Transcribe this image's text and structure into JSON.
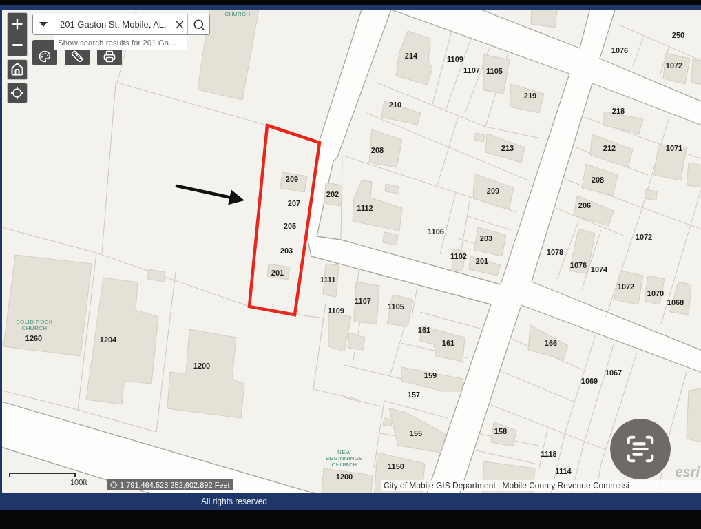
{
  "search": {
    "value": "201 Gaston St, Mobile, AL,",
    "suggestion": "Show search results for 201 Ga…"
  },
  "map": {
    "place_labels": [
      "CHURCH",
      "SOLID ROCK CHURCH",
      "NEW BEGINNINGS CHURCH"
    ],
    "address_labels": [
      "250",
      "1076",
      "214",
      "1109",
      "1072",
      "1107",
      "1105",
      "219",
      "210",
      "218",
      "208",
      "213",
      "212",
      "1071",
      "209",
      "208",
      "209",
      "202",
      "207",
      "206",
      "1112",
      "205",
      "1106",
      "1072",
      "203",
      "203",
      "1078",
      "1102",
      "201",
      "1076",
      "1074",
      "201",
      "1111",
      "1072",
      "1070",
      "1107",
      "1068",
      "1105",
      "1109",
      "161",
      "1260",
      "1204",
      "161",
      "166",
      "1200",
      "1067",
      "159",
      "1069",
      "157",
      "158",
      "155",
      "1118",
      "1150",
      "1114",
      "1200"
    ],
    "scale_label": "100ft",
    "coordinates": "1,791,464.523 252,602.892 Feet",
    "attribution": "City of Mobile GIS Department | Mobile County Revenue Commissi",
    "logo": "esri"
  },
  "footer": {
    "text": "All rights reserved"
  }
}
